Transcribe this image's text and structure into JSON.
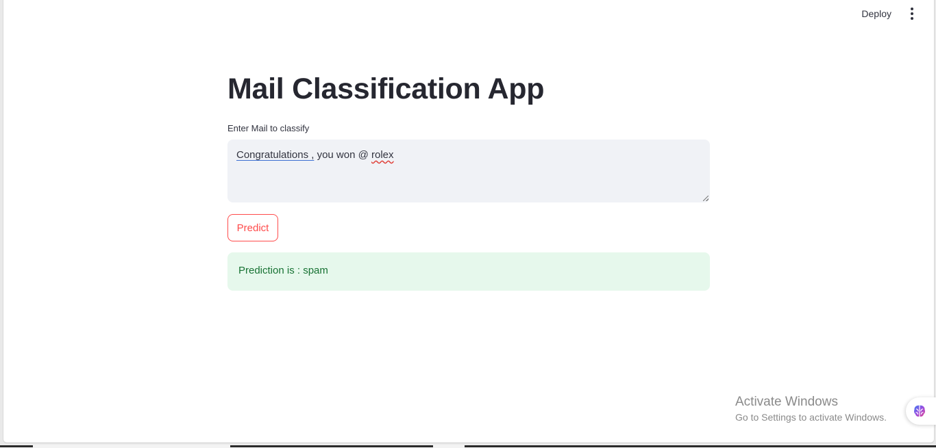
{
  "toolbar": {
    "deploy_label": "Deploy",
    "menu_icon": "kebab-menu-icon"
  },
  "main": {
    "title": "Mail Classification App",
    "input_label": "Enter Mail to classify",
    "input_value": {
      "word1": "Congratulations ,",
      "middle": " you won @ ",
      "word2": "rolex"
    },
    "predict_label": "Predict",
    "result_text": "Prediction is : spam"
  },
  "watermark": {
    "title": "Activate Windows",
    "subtitle": "Go to Settings to activate Windows."
  },
  "badge": {
    "icon": "brain-icon"
  },
  "colors": {
    "accent": "#ff4b4b",
    "success_bg": "#e6f8ec",
    "success_text": "#177233",
    "input_bg": "#f0f2f6"
  }
}
